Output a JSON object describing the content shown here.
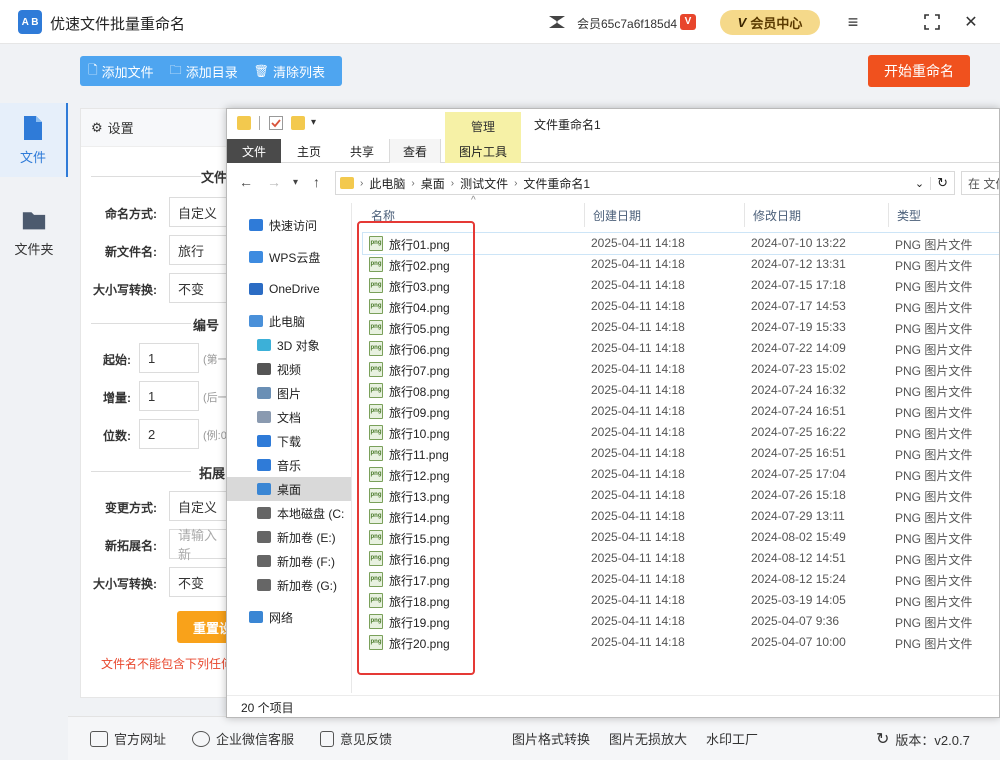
{
  "app": {
    "title": "优速文件批量重命名",
    "logo_text": "A B",
    "member_name": "会员65c7a6f185d4",
    "vip_badge": "V",
    "vip_center": "会员中心",
    "vip_center_logo": "V"
  },
  "window_controls": {
    "menu": "≡",
    "maximize": "⛶",
    "close": "✕"
  },
  "toolbar": {
    "add_file": "添加文件",
    "add_dir": "添加目录",
    "clear_list": "清除列表",
    "start": "开始重命名"
  },
  "leftnav": {
    "items": [
      {
        "label": "文件",
        "icon": "file-icon",
        "active": true
      },
      {
        "label": "文件夹",
        "icon": "folder-icon",
        "active": false
      }
    ]
  },
  "settings": {
    "header": "设置",
    "section1_title": "文件",
    "naming_label": "命名方式:",
    "naming_value": "自定义",
    "newname_label": "新文件名:",
    "newname_value": "旅行",
    "case_label": "大小写转换:",
    "case_value": "不变",
    "section2_title": "编号",
    "start_label": "起始:",
    "start_value": "1",
    "start_hint": "(第一",
    "inc_label": "增量:",
    "inc_value": "1",
    "inc_hint": "(后一",
    "digits_label": "位数:",
    "digits_value": "2",
    "digits_hint": "(例:0",
    "section3_title": "拓展",
    "ext_mode_label": "变更方式:",
    "ext_mode_value": "自定义",
    "new_ext_label": "新拓展名:",
    "new_ext_placeholder": "请输入新",
    "ext_case_label": "大小写转换:",
    "ext_case_value": "不变",
    "reset_button": "重置设",
    "warning": "文件名不能包含下列任何"
  },
  "explorer": {
    "manage_tab": "管理",
    "window_title": "文件重命名1",
    "ribbon": {
      "file": "文件",
      "home": "主页",
      "share": "共享",
      "view": "查看",
      "picture_tools": "图片工具"
    },
    "breadcrumb": [
      "此电脑",
      "桌面",
      "测试文件",
      "文件重命名1"
    ],
    "search_placeholder": "在 文件",
    "tree": [
      {
        "label": "快速访问",
        "icon": "star-icon",
        "color": "#2f7bd8"
      },
      {
        "label": "WPS云盘",
        "icon": "cloud-icon",
        "color": "#3d8be0"
      },
      {
        "label": "OneDrive",
        "icon": "onedrive-icon",
        "color": "#2b6cc4"
      },
      {
        "label": "此电脑",
        "icon": "computer-icon",
        "color": "#4a90d9"
      },
      {
        "label": "3D 对象",
        "icon": "cube-icon",
        "color": "#3cb0d8"
      },
      {
        "label": "视频",
        "icon": "video-icon",
        "color": "#555555"
      },
      {
        "label": "图片",
        "icon": "picture-icon",
        "color": "#6a8fb5"
      },
      {
        "label": "文档",
        "icon": "document-icon",
        "color": "#8a9ab0"
      },
      {
        "label": "下载",
        "icon": "download-icon",
        "color": "#2f7bd8"
      },
      {
        "label": "音乐",
        "icon": "music-icon",
        "color": "#2f7bd8"
      },
      {
        "label": "桌面",
        "icon": "desktop-icon",
        "color": "#3a86d4"
      },
      {
        "label": "本地磁盘 (C:",
        "icon": "drive-icon",
        "color": "#666666"
      },
      {
        "label": "新加卷 (E:)",
        "icon": "drive-icon",
        "color": "#666666"
      },
      {
        "label": "新加卷 (F:)",
        "icon": "drive-icon",
        "color": "#666666"
      },
      {
        "label": "新加卷 (G:)",
        "icon": "drive-icon",
        "color": "#666666"
      },
      {
        "label": "网络",
        "icon": "network-icon",
        "color": "#3a86d4"
      }
    ],
    "columns": {
      "name": "名称",
      "created": "创建日期",
      "modified": "修改日期",
      "type": "类型"
    },
    "files": [
      {
        "name": "旅行01.png",
        "created": "2025-04-11 14:18",
        "modified": "2024-07-10 13:22",
        "type": "PNG 图片文件"
      },
      {
        "name": "旅行02.png",
        "created": "2025-04-11 14:18",
        "modified": "2024-07-12 13:31",
        "type": "PNG 图片文件"
      },
      {
        "name": "旅行03.png",
        "created": "2025-04-11 14:18",
        "modified": "2024-07-15 17:18",
        "type": "PNG 图片文件"
      },
      {
        "name": "旅行04.png",
        "created": "2025-04-11 14:18",
        "modified": "2024-07-17 14:53",
        "type": "PNG 图片文件"
      },
      {
        "name": "旅行05.png",
        "created": "2025-04-11 14:18",
        "modified": "2024-07-19 15:33",
        "type": "PNG 图片文件"
      },
      {
        "name": "旅行06.png",
        "created": "2025-04-11 14:18",
        "modified": "2024-07-22 14:09",
        "type": "PNG 图片文件"
      },
      {
        "name": "旅行07.png",
        "created": "2025-04-11 14:18",
        "modified": "2024-07-23 15:02",
        "type": "PNG 图片文件"
      },
      {
        "name": "旅行08.png",
        "created": "2025-04-11 14:18",
        "modified": "2024-07-24 16:32",
        "type": "PNG 图片文件"
      },
      {
        "name": "旅行09.png",
        "created": "2025-04-11 14:18",
        "modified": "2024-07-24 16:51",
        "type": "PNG 图片文件"
      },
      {
        "name": "旅行10.png",
        "created": "2025-04-11 14:18",
        "modified": "2024-07-25 16:22",
        "type": "PNG 图片文件"
      },
      {
        "name": "旅行11.png",
        "created": "2025-04-11 14:18",
        "modified": "2024-07-25 16:51",
        "type": "PNG 图片文件"
      },
      {
        "name": "旅行12.png",
        "created": "2025-04-11 14:18",
        "modified": "2024-07-25 17:04",
        "type": "PNG 图片文件"
      },
      {
        "name": "旅行13.png",
        "created": "2025-04-11 14:18",
        "modified": "2024-07-26 15:18",
        "type": "PNG 图片文件"
      },
      {
        "name": "旅行14.png",
        "created": "2025-04-11 14:18",
        "modified": "2024-07-29 13:11",
        "type": "PNG 图片文件"
      },
      {
        "name": "旅行15.png",
        "created": "2025-04-11 14:18",
        "modified": "2024-08-02 15:49",
        "type": "PNG 图片文件"
      },
      {
        "name": "旅行16.png",
        "created": "2025-04-11 14:18",
        "modified": "2024-08-12 14:51",
        "type": "PNG 图片文件"
      },
      {
        "name": "旅行17.png",
        "created": "2025-04-11 14:18",
        "modified": "2024-08-12 15:24",
        "type": "PNG 图片文件"
      },
      {
        "name": "旅行18.png",
        "created": "2025-04-11 14:18",
        "modified": "2025-03-19 14:05",
        "type": "PNG 图片文件"
      },
      {
        "name": "旅行19.png",
        "created": "2025-04-11 14:18",
        "modified": "2025-04-07 9:36",
        "type": "PNG 图片文件"
      },
      {
        "name": "旅行20.png",
        "created": "2025-04-11 14:18",
        "modified": "2025-04-07 10:00",
        "type": "PNG 图片文件"
      }
    ],
    "png_icon_text": "png",
    "status": "20 个项目"
  },
  "footer": {
    "website": "官方网址",
    "wechat": "企业微信客服",
    "feedback": "意见反馈",
    "format_convert": "图片格式转换",
    "lossless": "图片无损放大",
    "watermark": "水印工厂",
    "version": "版本：v2.0.7"
  },
  "colors": {
    "accent": "#2f7bd8",
    "toolbar": "#4ea5f0",
    "start_button": "#f0511e",
    "reset_button": "#f9a21a",
    "highlight": "#e53935"
  }
}
